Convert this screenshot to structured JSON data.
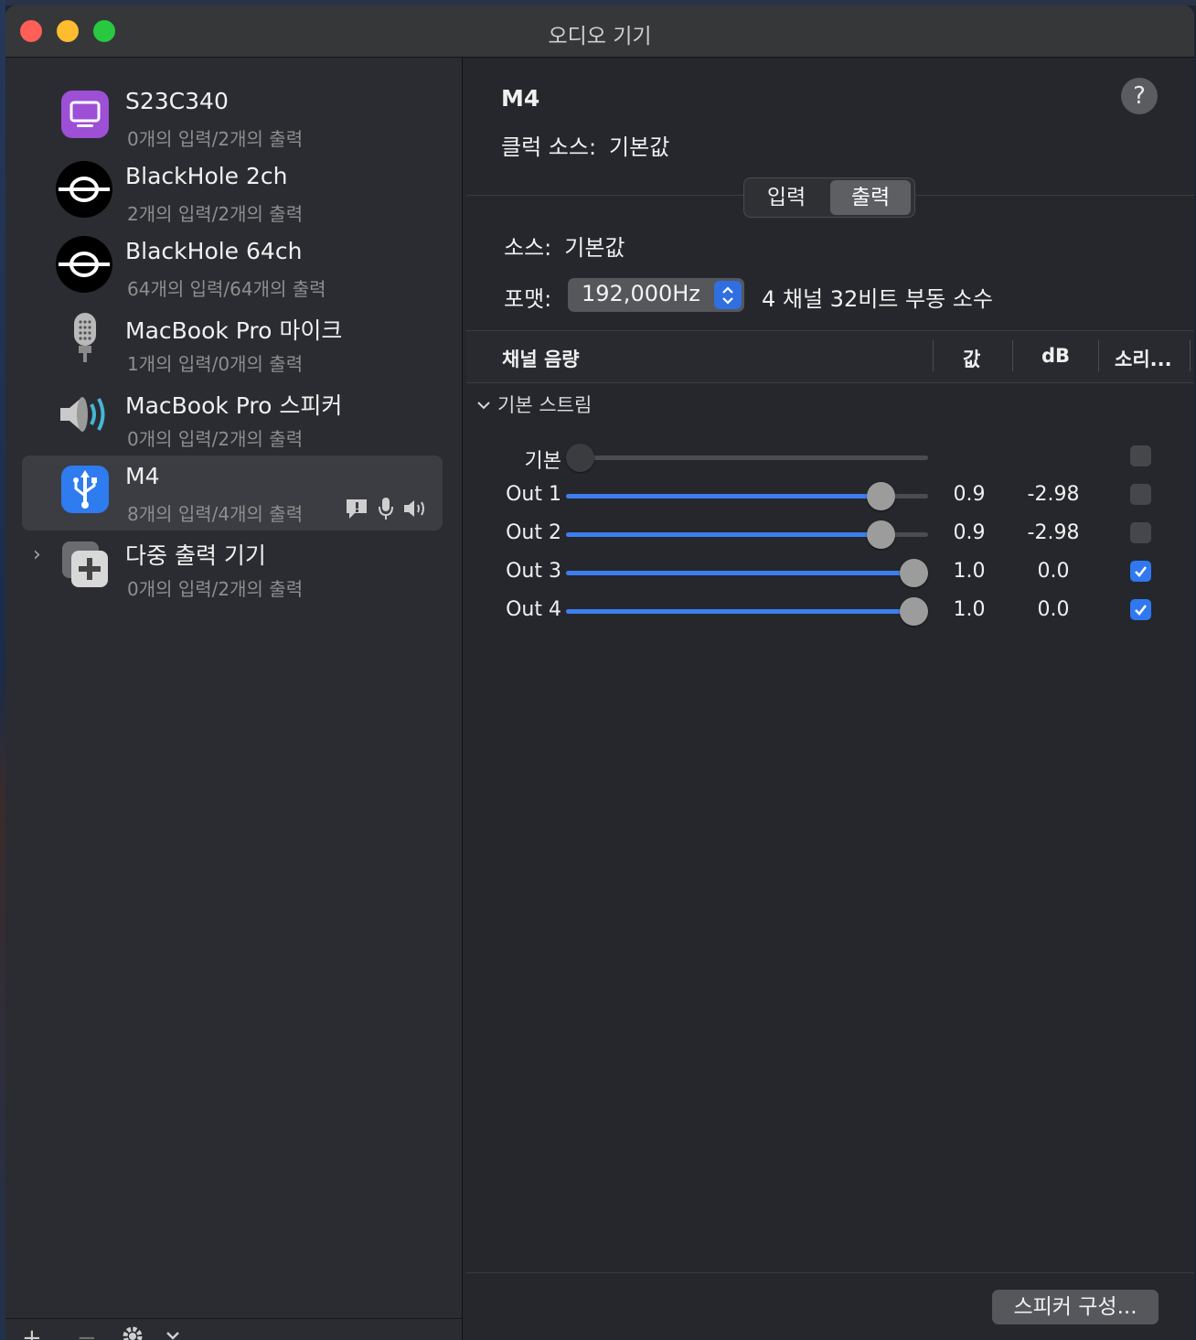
{
  "window": {
    "title": "오디오 기기"
  },
  "devices": [
    {
      "name": "S23C340",
      "sub": "0개의 입력/2개의 출력",
      "icon": "display-icon"
    },
    {
      "name": "BlackHole 2ch",
      "sub": "2개의 입력/2개의 출력",
      "icon": "blackhole-icon"
    },
    {
      "name": "BlackHole 64ch",
      "sub": "64개의 입력/64개의 출력",
      "icon": "blackhole-icon"
    },
    {
      "name": "MacBook Pro 마이크",
      "sub": "1개의 입력/0개의 출력",
      "icon": "microphone-icon"
    },
    {
      "name": "MacBook Pro 스피커",
      "sub": "0개의 입력/2개의 출력",
      "icon": "speaker-icon"
    },
    {
      "name": "M4",
      "sub": "8개의 입력/4개의 출력",
      "icon": "usb-icon",
      "selected": true
    },
    {
      "name": "다중 출력 기기",
      "sub": "0개의 입력/2개의 출력",
      "icon": "multi-output-icon"
    }
  ],
  "sidebar_footer": {
    "add": "+",
    "remove": "−"
  },
  "detail": {
    "device_name": "M4",
    "help": "?",
    "clock_label": "클럭 소스:",
    "clock_value": "기본값",
    "tabs": {
      "input": "입력",
      "output": "출력",
      "active": "output"
    },
    "source_label": "소스:",
    "source_value": "기본값",
    "format_label": "포맷:",
    "format_value": "192,000Hz",
    "format_desc": "4 채널 32비트 부동 소수"
  },
  "table": {
    "headers": {
      "channel": "채널 음량",
      "value": "값",
      "db": "dB",
      "mute": "소리..."
    },
    "group": "기본 스트림",
    "rows": [
      {
        "label": "기본",
        "level": 0.0,
        "value": "",
        "db": "",
        "checked": false,
        "enabled": false
      },
      {
        "label": "Out 1",
        "level": 0.9,
        "value": "0.9",
        "db": "-2.98",
        "checked": false,
        "enabled": true
      },
      {
        "label": "Out 2",
        "level": 0.9,
        "value": "0.9",
        "db": "-2.98",
        "checked": false,
        "enabled": true
      },
      {
        "label": "Out 3",
        "level": 1.0,
        "value": "1.0",
        "db": "0.0",
        "checked": true,
        "enabled": true
      },
      {
        "label": "Out 4",
        "level": 1.0,
        "value": "1.0",
        "db": "0.0",
        "checked": true,
        "enabled": true
      }
    ]
  },
  "footer": {
    "configure_speakers": "스피커 구성..."
  },
  "colors": {
    "accent": "#3d7eee",
    "selected_row": "#3b3d42"
  }
}
